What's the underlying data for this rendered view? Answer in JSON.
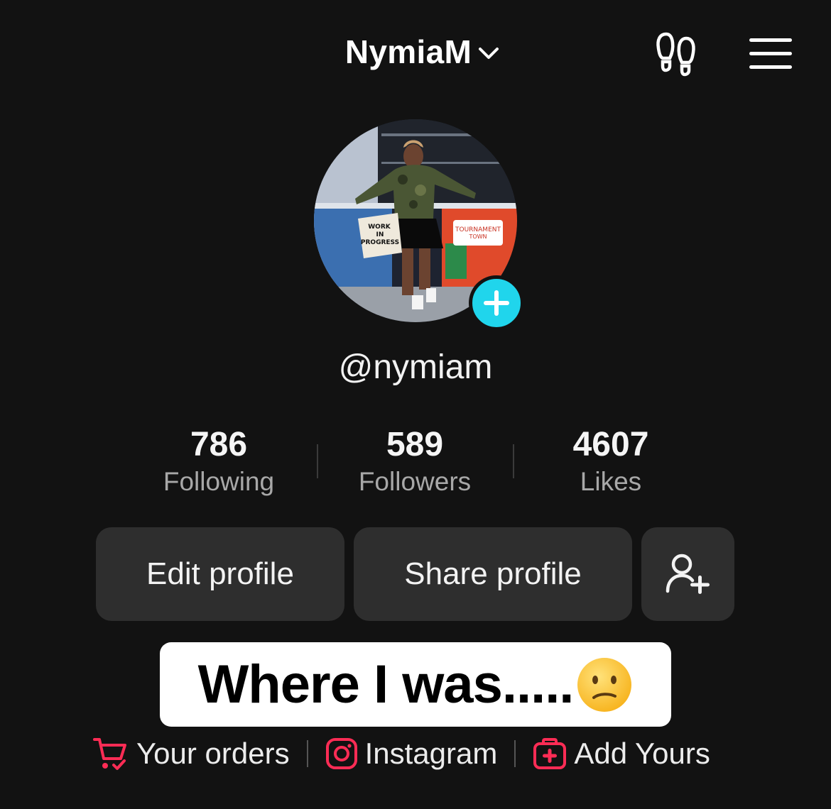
{
  "header": {
    "username": "NymiaM"
  },
  "profile": {
    "handle": "@nymiam",
    "avatar_sign": {
      "line1": "WORK",
      "line2": "IN",
      "line3": "PROGRESS"
    },
    "avatar_banner": {
      "line1": "TOURNAMENT",
      "line2": "TOWN"
    }
  },
  "stats": [
    {
      "value": "786",
      "label": "Following"
    },
    {
      "value": "589",
      "label": "Followers"
    },
    {
      "value": "4607",
      "label": "Likes"
    }
  ],
  "buttons": {
    "edit": "Edit profile",
    "share": "Share profile"
  },
  "caption": {
    "text": "Where I was....."
  },
  "links": [
    {
      "label": "Your orders",
      "icon": "cart-icon"
    },
    {
      "label": "Instagram",
      "icon": "instagram-icon"
    },
    {
      "label": "Add Yours",
      "icon": "add-yours-icon"
    }
  ],
  "colors": {
    "background": "#121212",
    "accent_cyan": "#20d5ec",
    "link_icon": "#fe2c55",
    "button_bg": "#2e2e2e"
  }
}
